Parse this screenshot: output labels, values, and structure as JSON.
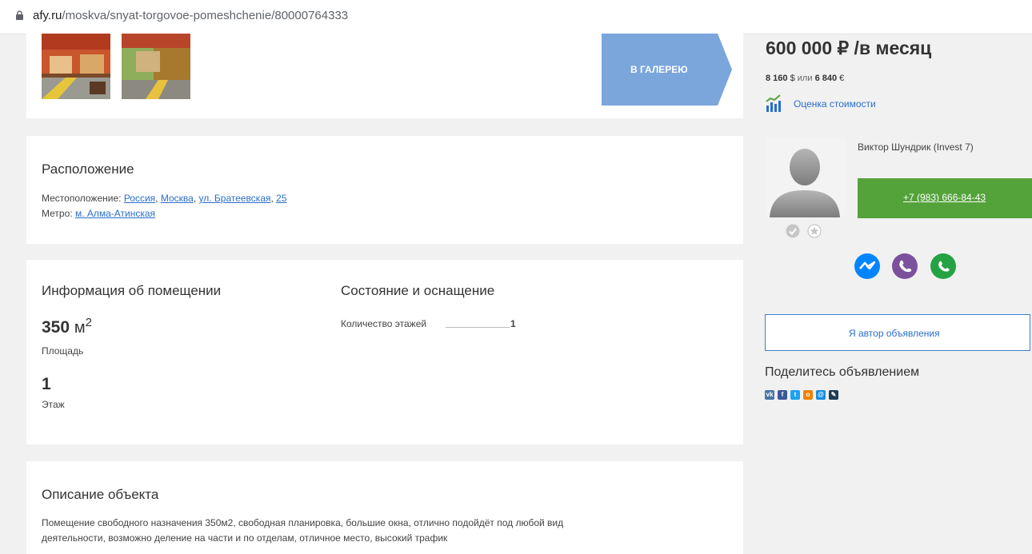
{
  "browser": {
    "url_host": "afy.ru",
    "url_path": "/moskva/snyat-torgovoe-pomeshchenie/80000764333"
  },
  "gallery": {
    "button_label": "В ГАЛЕРЕЮ"
  },
  "location": {
    "heading": "Расположение",
    "location_label": "Местоположение:",
    "country": "Россия",
    "city": "Москва",
    "street": "ул. Братеевская",
    "house": "25",
    "metro_label": "Метро:",
    "metro": "м. Алма-Атинская"
  },
  "info": {
    "heading": "Информация об помещении",
    "area_value": "350",
    "area_unit": "м",
    "area_sup": "2",
    "area_label": "Площадь",
    "floor_value": "1",
    "floor_label": "Этаж"
  },
  "condition": {
    "heading": "Состояние и оснащение",
    "floors_label": "Количество этажей",
    "floors_value": "1"
  },
  "description": {
    "heading": "Описание объекта",
    "line1": "Помещение свободного назначения 350м2, свободная планировка, большие окна, отлично подойдёт под любой вид",
    "line2": "деятельности, возможно деление на части и по отделам, отличное место, высокий трафик"
  },
  "price": {
    "main": "600 000 ₽ /в месяц",
    "usd_value": "8 160",
    "usd_sym": "$",
    "or": "или",
    "eur_value": "6 840",
    "eur_sym": "€",
    "estimate_link": "Оценка стоимости"
  },
  "agent": {
    "name": "Виктор Шундрик (Invest 7)",
    "phone": "+7 (983) 666-84-43"
  },
  "author_button": "Я автор объявления",
  "share": {
    "heading": "Поделитесь объявлением"
  },
  "colors": {
    "gallery_arrow": "#7aa6dc",
    "phone_button": "#54a23a",
    "link": "#2a6fc9",
    "messenger": "#0084ff",
    "viber": "#7b519d",
    "whatsapp": "#25a244"
  }
}
